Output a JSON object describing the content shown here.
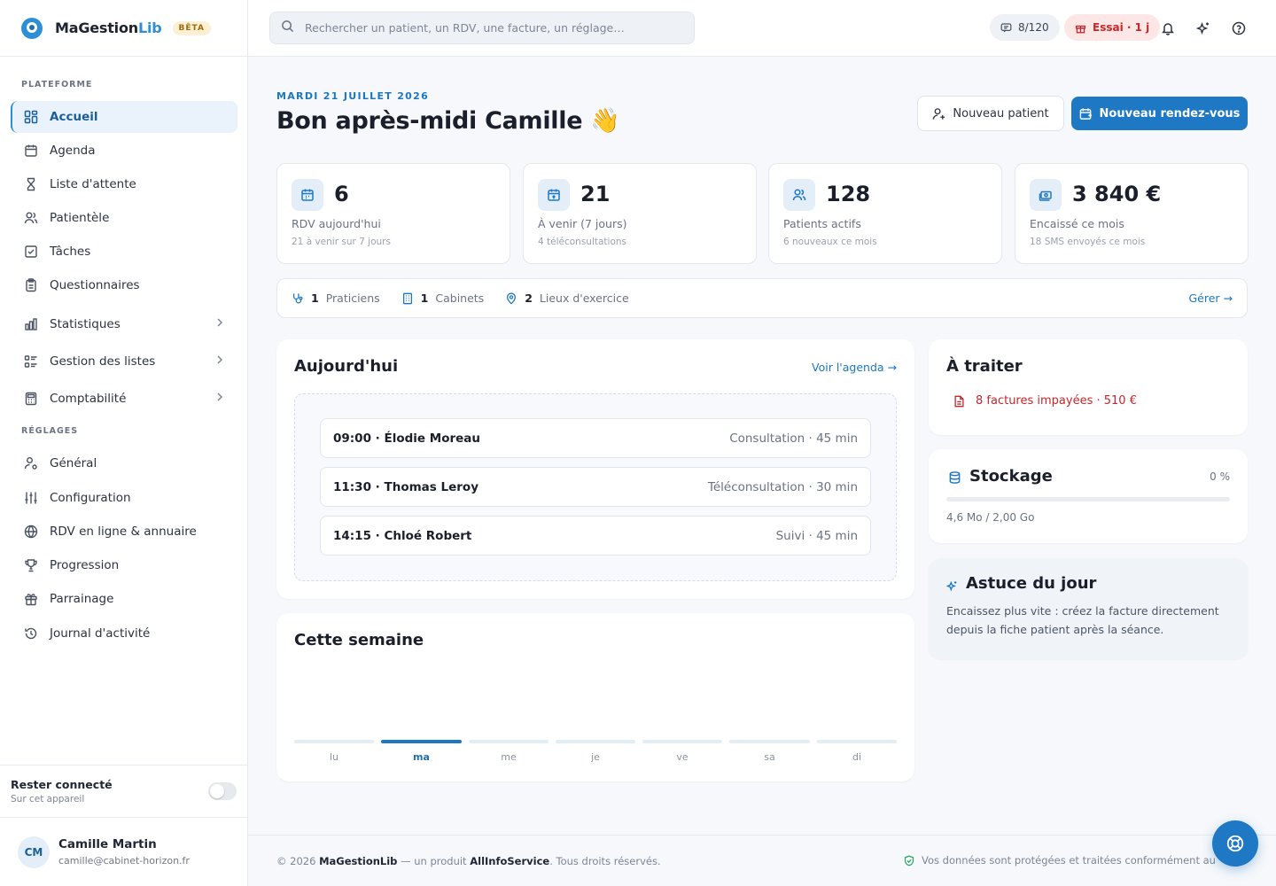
{
  "brand": {
    "name_part1": "MaGestion",
    "name_part2": "Lib",
    "badge": "BÊTA"
  },
  "sidebar": {
    "section_platform": "PLATEFORME",
    "section_settings": "RÉGLAGES",
    "items": [
      {
        "label": "Accueil",
        "icon": "dashboard-icon"
      },
      {
        "label": "Agenda",
        "icon": "calendar-icon"
      },
      {
        "label": "Liste d'attente",
        "icon": "hourglass-icon"
      },
      {
        "label": "Patientèle",
        "icon": "users-icon"
      },
      {
        "label": "Tâches",
        "icon": "checkbox-icon"
      },
      {
        "label": "Questionnaires",
        "icon": "clipboard-icon"
      },
      {
        "label": "Statistiques",
        "icon": "bar-chart-icon"
      },
      {
        "label": "Gestion des listes",
        "icon": "list-icon"
      },
      {
        "label": "Comptabilité",
        "icon": "calculator-icon"
      }
    ],
    "settings_items": [
      {
        "label": "Général",
        "icon": "user-gear-icon"
      },
      {
        "label": "Configuration",
        "icon": "sliders-icon"
      },
      {
        "label": "RDV en ligne & annuaire",
        "icon": "globe-icon"
      },
      {
        "label": "Progression",
        "icon": "trophy-icon"
      },
      {
        "label": "Parrainage",
        "icon": "gift-icon"
      },
      {
        "label": "Journal d'activité",
        "icon": "history-icon"
      }
    ],
    "stay_connected": {
      "title": "Rester connecté",
      "subtitle": "Sur cet appareil"
    },
    "user": {
      "initials": "CM",
      "name": "Camille Martin",
      "email": "camille@cabinet-horizon.fr"
    }
  },
  "topbar": {
    "search_placeholder": "Rechercher un patient, un RDV, une facture, un réglage…",
    "sms_count": "8/120",
    "trial": "Essai · 1 j"
  },
  "header": {
    "date": "MARDI 21 JUILLET 2026",
    "greeting": "Bon après-midi Camille 👋",
    "new_patient": "Nouveau patient",
    "new_appointment": "Nouveau rendez-vous"
  },
  "kpis": [
    {
      "value": "6",
      "label": "RDV aujourd'hui",
      "sub": "21 à venir sur 7 jours",
      "icon": "calendar-icon"
    },
    {
      "value": "21",
      "label": "À venir (7 jours)",
      "sub": "4 téléconsultations",
      "icon": "calendar-arrow-icon"
    },
    {
      "value": "128",
      "label": "Patients actifs",
      "sub": "6 nouveaux ce mois",
      "icon": "users-icon"
    },
    {
      "value": "3 840 €",
      "label": "Encaissé ce mois",
      "sub": "18 SMS envoyés ce mois",
      "icon": "cash-icon"
    }
  ],
  "infobar": {
    "practitioners_count": "1",
    "practitioners_label": "Praticiens",
    "cabinets_count": "1",
    "cabinets_label": "Cabinets",
    "places_count": "2",
    "places_label": "Lieux d'exercice",
    "manage": "Gérer →"
  },
  "today": {
    "title": "Aujourd'hui",
    "link": "Voir l'agenda →",
    "appointments": [
      {
        "main": "09:00 · Élodie Moreau",
        "type": "Consultation · 45 min"
      },
      {
        "main": "11:30 · Thomas Leroy",
        "type": "Téléconsultation · 30 min"
      },
      {
        "main": "14:15 · Chloé Robert",
        "type": "Suivi · 45 min"
      }
    ]
  },
  "week": {
    "title": "Cette semaine",
    "days": [
      "lu",
      "ma",
      "me",
      "je",
      "ve",
      "sa",
      "di"
    ],
    "active_day": "ma"
  },
  "todo": {
    "title": "À traiter",
    "item": "8 factures impayées · 510 €"
  },
  "storage": {
    "title": "Stockage",
    "percent_label": "0 %",
    "percent": 0,
    "usage": "4,6 Mo / 2,00 Go"
  },
  "tip": {
    "title": "Astuce du jour",
    "text": "Encaissez plus vite : créez la facture directement depuis la fiche patient après la séance."
  },
  "footer": {
    "prefix": "© 2026",
    "brand": "MaGestionLib",
    "middle": "— un produit",
    "company": "AllInfoService",
    "suffix": ". Tous droits réservés.",
    "privacy": "Vos données sont protégées et traitées conformément au"
  },
  "colors": {
    "primary": "#1f78c4",
    "accent_light": "#e4eef8",
    "danger": "#c7262b"
  }
}
